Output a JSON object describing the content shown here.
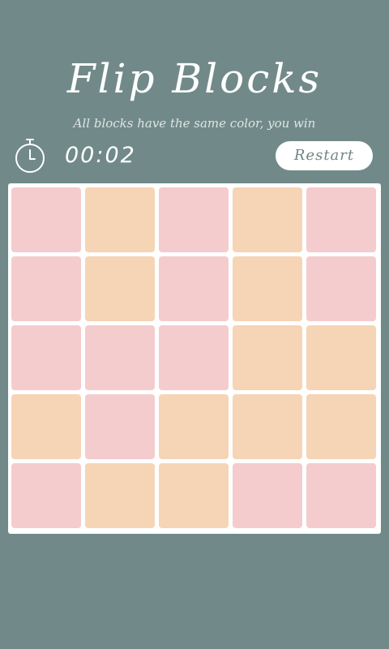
{
  "app": {
    "title": "Flip Blocks",
    "subtitle": "All blocks have the same color, you win"
  },
  "status": {
    "timer": "00:02",
    "clock_icon": "stopwatch-icon"
  },
  "controls": {
    "restart_label": "Restart"
  },
  "colors": {
    "background": "#718a89",
    "board": "#ffffff",
    "pink": "#f4cccd",
    "peach": "#f5d5b5"
  },
  "board": {
    "rows": 5,
    "cols": 5,
    "cells": [
      [
        "pink",
        "peach",
        "pink",
        "peach",
        "pink"
      ],
      [
        "pink",
        "peach",
        "pink",
        "peach",
        "pink"
      ],
      [
        "pink",
        "pink",
        "pink",
        "peach",
        "peach"
      ],
      [
        "peach",
        "pink",
        "peach",
        "peach",
        "peach"
      ],
      [
        "pink",
        "peach",
        "peach",
        "pink",
        "pink"
      ]
    ]
  }
}
